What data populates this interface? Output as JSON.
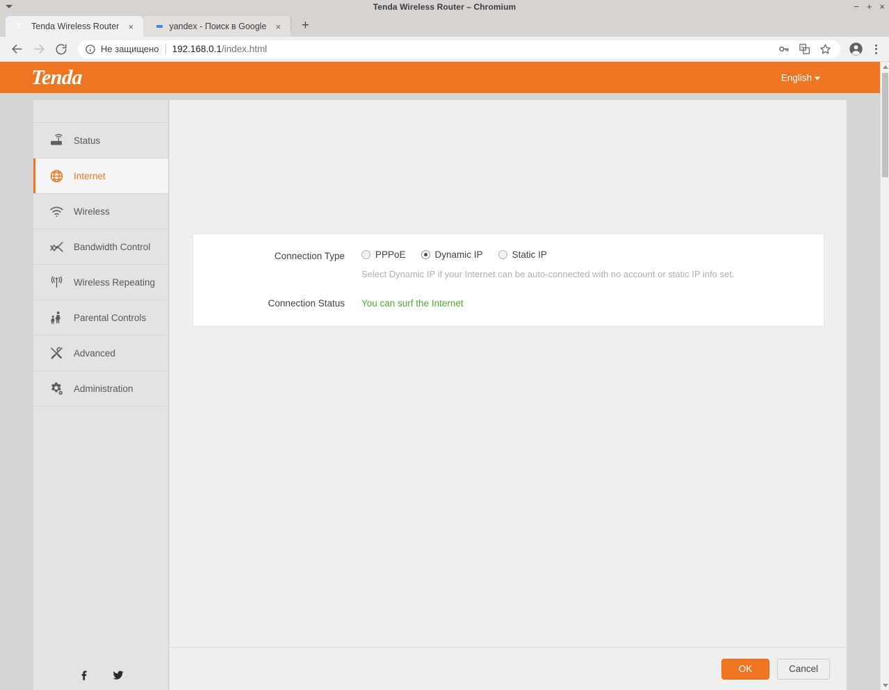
{
  "window": {
    "title": "Tenda Wireless Router – Chromium",
    "minimize": "−",
    "maximize": "+",
    "close": "×"
  },
  "tabs": [
    {
      "title": "Tenda Wireless Router",
      "favicon": "tenda-icon",
      "active": true,
      "close": "×"
    },
    {
      "title": "yandex - Поиск в Google",
      "favicon": "google-icon",
      "active": false,
      "close": "×"
    }
  ],
  "new_tab_label": "+",
  "omnibox": {
    "security_icon": "info-circle-icon",
    "security_text": "Не защищено",
    "url_host": "192.168.0.1",
    "url_path": "/index.html",
    "actions": [
      "key-icon",
      "translate-icon",
      "star-icon"
    ]
  },
  "toolbar": {
    "back": "back-arrow-icon",
    "forward": "forward-arrow-icon",
    "reload": "reload-icon",
    "profile": "profile-avatar-icon",
    "menu": "three-dot-menu-icon"
  },
  "header": {
    "brand": "Tenda",
    "language": "English",
    "brand_color": "#ee7623"
  },
  "sidebar": {
    "items": [
      {
        "label": "Status",
        "icon": "router-icon",
        "active": false
      },
      {
        "label": "Internet",
        "icon": "globe-icon",
        "active": true
      },
      {
        "label": "Wireless",
        "icon": "wifi-icon",
        "active": false
      },
      {
        "label": "Bandwidth Control",
        "icon": "chart-line-icon",
        "active": false
      },
      {
        "label": "Wireless Repeating",
        "icon": "antenna-icon",
        "active": false
      },
      {
        "label": "Parental Controls",
        "icon": "parent-child-icon",
        "active": false
      },
      {
        "label": "Advanced",
        "icon": "tools-icon",
        "active": false
      },
      {
        "label": "Administration",
        "icon": "gear-icon",
        "active": false
      }
    ],
    "social": [
      {
        "name": "facebook-icon"
      },
      {
        "name": "twitter-icon"
      }
    ]
  },
  "form": {
    "connection_type_label": "Connection Type",
    "options": [
      {
        "label": "PPPoE",
        "selected": false
      },
      {
        "label": "Dynamic IP",
        "selected": true
      },
      {
        "label": "Static IP",
        "selected": false
      }
    ],
    "hint": "Select Dynamic IP if your Internet can be auto-connected with no account or static IP info set.",
    "connection_status_label": "Connection Status",
    "connection_status_value": "You can surf the Internet",
    "status_color": "#4caf2a"
  },
  "footer": {
    "ok_label": "OK",
    "cancel_label": "Cancel"
  }
}
